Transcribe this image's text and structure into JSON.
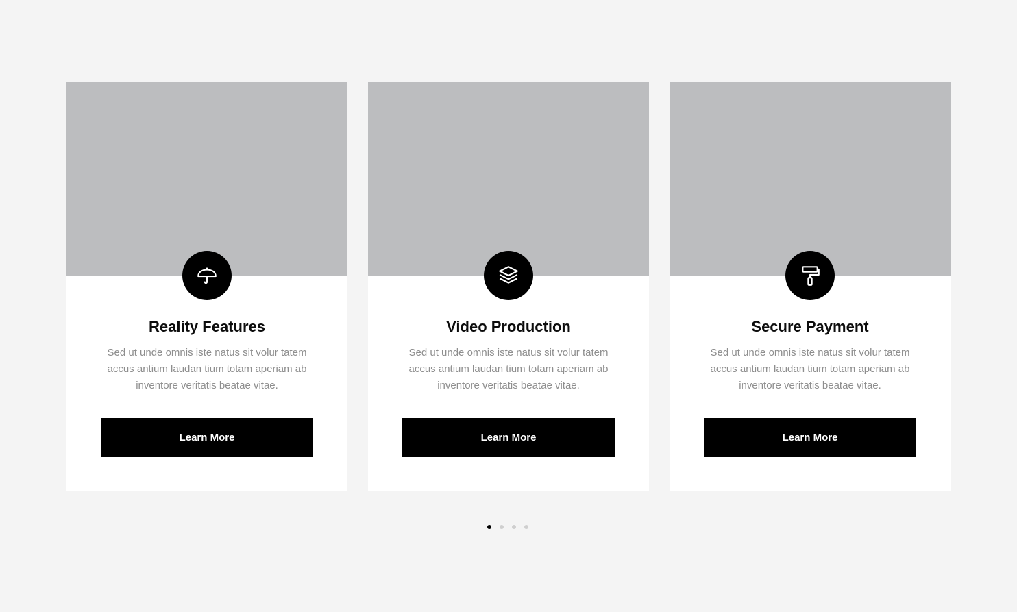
{
  "cards": [
    {
      "title": "Reality Features",
      "text": "Sed ut unde omnis iste natus sit volur tatem accus antium laudan tium totam aperiam ab inventore veritatis beatae vitae.",
      "button": "Learn More",
      "icon": "umbrella-icon"
    },
    {
      "title": "Video Production",
      "text": "Sed ut unde omnis iste natus sit volur tatem accus antium laudan tium totam aperiam ab inventore veritatis beatae vitae.",
      "button": "Learn More",
      "icon": "layers-icon"
    },
    {
      "title": "Secure Payment",
      "text": "Sed ut unde omnis iste natus sit volur tatem accus antium laudan tium totam aperiam ab inventore veritatis beatae vitae.",
      "button": "Learn More",
      "icon": "paint-roller-icon"
    }
  ],
  "pagination": {
    "count": 4,
    "active_index": 0
  },
  "colors": {
    "page_background": "#f4f4f4",
    "card_background": "#ffffff",
    "image_placeholder": "#bcbdbf",
    "accent": "#000000",
    "body_text": "#8e8e8e",
    "inactive_dot": "#cfcfcf"
  }
}
